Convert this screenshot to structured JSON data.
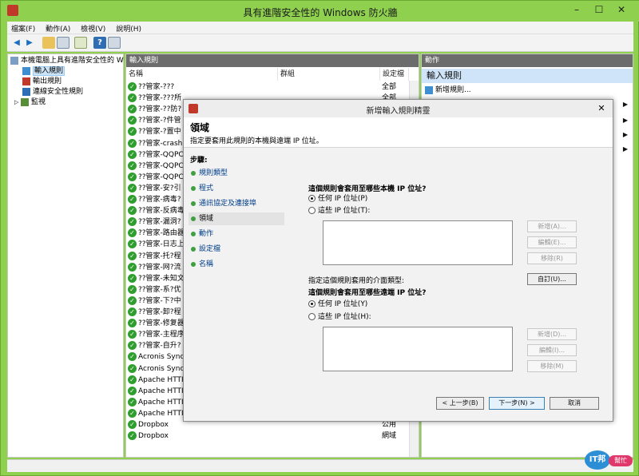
{
  "window": {
    "title": "具有進階安全性的 Windows 防火牆"
  },
  "menu": [
    "檔案(F)",
    "動作(A)",
    "檢視(V)",
    "說明(H)"
  ],
  "tree": {
    "root": "本機電腦上具有進階安全性的 W",
    "items": [
      "輸入規則",
      "輸出規則",
      "連線安全性規則",
      "監視"
    ]
  },
  "list": {
    "header": "輸入規則",
    "columns": {
      "name": "名稱",
      "group": "群組",
      "profile": "設定檔"
    },
    "rows": [
      {
        "name": "??管家-???",
        "profile": "全部"
      },
      {
        "name": "??管家-???所",
        "profile": "全部"
      },
      {
        "name": "??管家-??防?",
        "profile": ""
      },
      {
        "name": "??管家-?件管",
        "profile": ""
      },
      {
        "name": "??管家-?置中",
        "profile": ""
      },
      {
        "name": "??管家-crash",
        "profile": ""
      },
      {
        "name": "??管家-QQPC",
        "profile": ""
      },
      {
        "name": "??管家-QQPC",
        "profile": ""
      },
      {
        "name": "??管家-QQPC",
        "profile": ""
      },
      {
        "name": "??管家-安?引",
        "profile": ""
      },
      {
        "name": "??管家-病毒?",
        "profile": ""
      },
      {
        "name": "??管家-反病毒",
        "profile": ""
      },
      {
        "name": "??管家-漏洞?",
        "profile": ""
      },
      {
        "name": "??管家-路由器",
        "profile": ""
      },
      {
        "name": "??管家-日志上",
        "profile": ""
      },
      {
        "name": "??管家-托?程",
        "profile": ""
      },
      {
        "name": "??管家-网?流",
        "profile": ""
      },
      {
        "name": "??管家-未知文",
        "profile": ""
      },
      {
        "name": "??管家-系?优",
        "profile": ""
      },
      {
        "name": "??管家-下?中",
        "profile": ""
      },
      {
        "name": "??管家-卸?程",
        "profile": ""
      },
      {
        "name": "??管家-修复器",
        "profile": ""
      },
      {
        "name": "??管家-主程序",
        "profile": ""
      },
      {
        "name": "??管家-自升?",
        "profile": ""
      },
      {
        "name": "Acronis Sync",
        "profile": ""
      },
      {
        "name": "Acronis Sync",
        "profile": ""
      },
      {
        "name": "Apache HTTI",
        "profile": ""
      },
      {
        "name": "Apache HTTI",
        "profile": ""
      },
      {
        "name": "Apache HTTI",
        "profile": ""
      },
      {
        "name": "Apache HTTI",
        "profile": ""
      },
      {
        "name": "Dropbox",
        "profile": "公用"
      },
      {
        "name": "Dropbox",
        "profile": "網域"
      }
    ]
  },
  "actions": {
    "header": "動作",
    "section": "輸入規則",
    "new_rule": "新增規則..."
  },
  "wizard": {
    "title": "新增輸入規則精靈",
    "heading": "領域",
    "subheading": "指定要套用此規則的本機與遠端 IP 位址。",
    "steps_label": "步驟:",
    "steps": [
      "規則類型",
      "程式",
      "通訊協定及連接埠",
      "領域",
      "動作",
      "設定檔",
      "名稱"
    ],
    "local_question": "這個規則會套用至哪些本機 IP 位址?",
    "local_any": "任何 IP 位址(P)",
    "local_these": "這些 IP 位址(T):",
    "remote_question": "這個規則會套用至哪些遠端 IP 位址?",
    "remote_any": "任何 IP 位址(Y)",
    "remote_these": "這些 IP 位址(H):",
    "add_local": "新增(A)...",
    "edit_local": "編輯(E)...",
    "remove_local": "移除(R)",
    "add_remote": "新增(D)...",
    "edit_remote": "編輯(I)...",
    "remove_remote": "移除(M)",
    "iface_label": "指定這個規則套用的介面類型:",
    "customize": "自訂(U)...",
    "back": "< 上一步(B)",
    "next": "下一步(N) >",
    "cancel": "取消"
  },
  "watermark": {
    "part1": "IT邦",
    "part2": "幫忙"
  }
}
